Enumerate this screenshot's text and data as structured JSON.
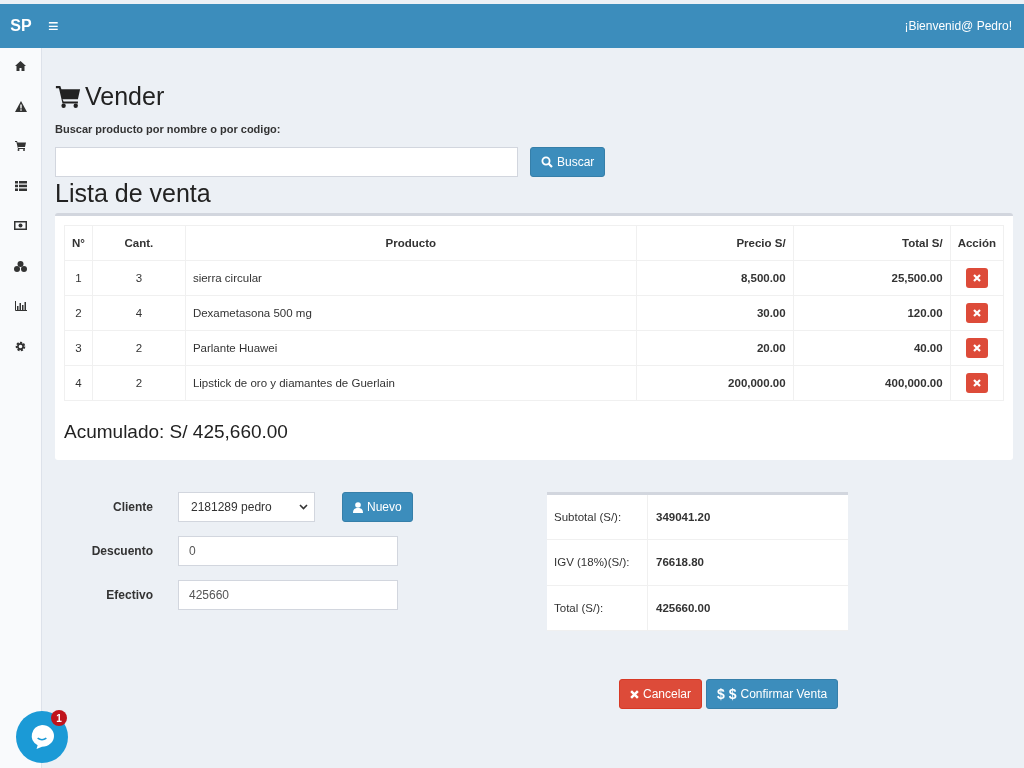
{
  "topbar": {
    "logo": "SP",
    "menu_glyph": "≡",
    "greeting": "¡Bienvenid@ Pedro!"
  },
  "sidebar": {
    "items": [
      {
        "kind": "home",
        "selected": false
      },
      {
        "kind": "warning",
        "selected": false
      },
      {
        "kind": "cart",
        "selected": false
      },
      {
        "kind": "list",
        "selected": false
      },
      {
        "kind": "money",
        "selected": false
      },
      {
        "kind": "cubes",
        "selected": false
      },
      {
        "kind": "chart",
        "selected": false
      },
      {
        "kind": "gear",
        "selected": false
      }
    ]
  },
  "page": {
    "title": "Vender",
    "search_label": "Buscar producto por nombre o por codigo:",
    "search_button": "Buscar",
    "list_title": "Lista de venta"
  },
  "table": {
    "columns": [
      "N°",
      "Cant.",
      "Producto",
      "Precio S/",
      "Total S/",
      "Acción"
    ],
    "rows": [
      {
        "n": "1",
        "qty": "3",
        "product": "sierra circular",
        "price": "8,500.00",
        "total": "25,500.00"
      },
      {
        "n": "2",
        "qty": "4",
        "product": "Dexametasona 500 mg",
        "price": "30.00",
        "total": "120.00"
      },
      {
        "n": "3",
        "qty": "2",
        "product": "Parlante Huawei",
        "price": "20.00",
        "total": "40.00"
      },
      {
        "n": "4",
        "qty": "2",
        "product": "Lipstick de oro y diamantes de Guerlain",
        "price": "200,000.00",
        "total": "400,000.00"
      }
    ]
  },
  "accumulated": "Acumulado: S/ 425,660.00",
  "form": {
    "cliente_label": "Cliente",
    "cliente_value": "2181289 pedro",
    "nuevo_button": "Nuevo",
    "descuento_label": "Descuento",
    "descuento_value": "0",
    "efectivo_label": "Efectivo",
    "efectivo_value": "425660"
  },
  "summary": [
    {
      "label": "Subtotal (S/):",
      "value": "349041.20"
    },
    {
      "label": "IGV (18%)(S/):",
      "value": "76618.80"
    },
    {
      "label": "Total (S/):",
      "value": "425660.00"
    }
  ],
  "actions": {
    "cancel": "Cancelar",
    "confirm_glyph": "$ $",
    "confirm": "Confirmar Venta"
  },
  "chat": {
    "badge": "1"
  }
}
